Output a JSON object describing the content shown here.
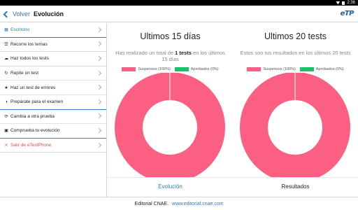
{
  "statusbar": {
    "time": "2:36"
  },
  "header": {
    "back_label": "Volver",
    "title": "Evolución",
    "logo_text": "eTP"
  },
  "sidebar": {
    "items": [
      {
        "label": "Escritorio",
        "icon": "grid-icon",
        "glyph": "▦"
      },
      {
        "label": "Recorre los temas",
        "icon": "list-icon",
        "glyph": "☰"
      },
      {
        "label": "Haz todos los tests",
        "icon": "cloud-icon",
        "glyph": "☁"
      },
      {
        "label": "Repite un test",
        "icon": "refresh-icon",
        "glyph": "↻"
      },
      {
        "label": "Haz un test de errores",
        "icon": "star-icon",
        "glyph": "★"
      },
      {
        "label": "Prepárate para el examen",
        "icon": "half-circle-icon",
        "glyph": "◑"
      },
      {
        "label": "Cambia a otra prueba",
        "icon": "sync-icon",
        "glyph": "⟳"
      },
      {
        "label": "Comprueba tu evolución",
        "icon": "calendar-icon",
        "glyph": "▣"
      },
      {
        "label": "Salir de eTestPhone",
        "icon": "close-icon",
        "glyph": "✕"
      }
    ]
  },
  "panels": [
    {
      "title": "Ultimos 15 días",
      "desc_before": "Has realizado un total de ",
      "desc_bold": "1 tests",
      "desc_after": " en los últimos 15 días",
      "legend": [
        {
          "label": "Suspensos (100%)",
          "color": "#fb6083"
        },
        {
          "label": "Aprobados (0%)",
          "color": "#18c36b"
        }
      ],
      "chart_data": {
        "type": "pie",
        "categories": [
          "Suspensos",
          "Aprobados"
        ],
        "values": [
          100,
          0
        ]
      }
    },
    {
      "title": "Ultimos 20 tests",
      "desc_before": "Estos son tus resultados en los últimos 20 tests",
      "desc_bold": "",
      "desc_after": "",
      "legend": [
        {
          "label": "Suspensos (100%)",
          "color": "#fb6083"
        },
        {
          "label": "Aprobados (0%)",
          "color": "#18c36b"
        }
      ],
      "chart_data": {
        "type": "pie",
        "categories": [
          "Suspensos",
          "Aprobados"
        ],
        "values": [
          100,
          0
        ]
      }
    }
  ],
  "tabs": [
    {
      "label": "Evolución",
      "active": true
    },
    {
      "label": "Resultados",
      "active": false
    }
  ],
  "footer": {
    "editorial": "Editorial CNAE.",
    "url": "www.editorial.cnae.com"
  },
  "colors": {
    "accent": "#2a78c8",
    "failed": "#fb6083",
    "passed": "#18c36b",
    "danger": "#e0524e"
  }
}
